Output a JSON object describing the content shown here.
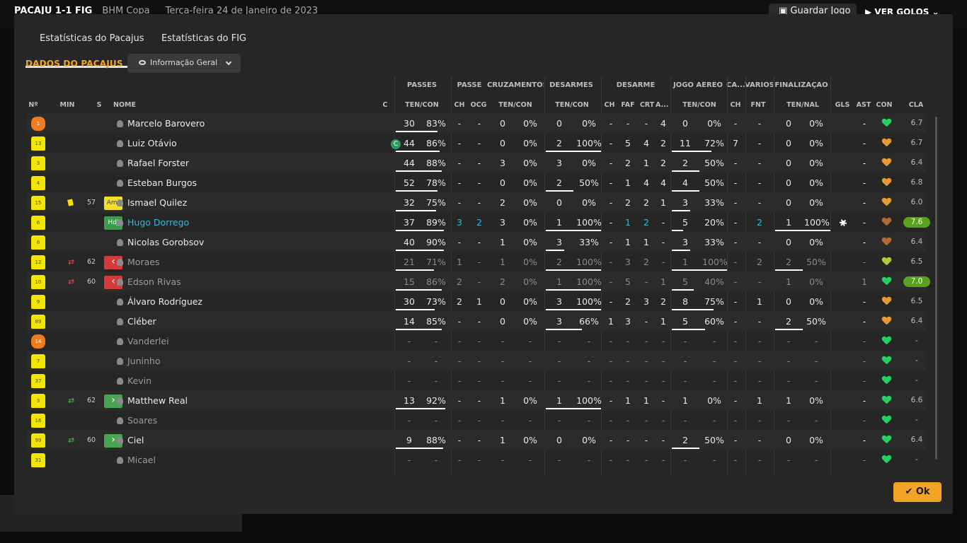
{
  "topbar": {
    "score": "PACAJU 1-1 FIG",
    "competition": "BHM Copa",
    "date": "Terça-feira 24 de Janeiro de 2023",
    "save_label": "Guardar Jogo",
    "goals_label": "VER GOLOS"
  },
  "modal": {
    "tabs": [
      "Estatísticas do Pacajus",
      "Estatísticas do FIG"
    ],
    "section_title": "DADOS DO PACAJUS",
    "view_dropdown": "Informação Geral",
    "ok_label": "Ok",
    "groups": [
      "PASSES",
      "PASSE",
      "CRUZAMENTOS",
      "DESARMES",
      "DESARME",
      "JOGO AÉREO",
      "CA...",
      "VÁRIOS",
      "FINALIZAÇÃO"
    ],
    "columns": [
      "Nº",
      "MIN",
      "S",
      "NOME",
      "C",
      "TEN/CON",
      "CH",
      "OCG",
      "TEN/CON",
      "TEN/CON",
      "CH",
      "FAF",
      "CRT",
      "A...",
      "TEN/CON",
      "CH",
      "FNT",
      "TEN/NAL",
      "GLS",
      "AST",
      "CON",
      "CLA"
    ]
  },
  "players": [
    {
      "num": "1",
      "gk": true,
      "min": "",
      "swap": "",
      "badge": "",
      "name": "Marcelo Barovero",
      "captain": false,
      "style": "",
      "p": [
        "30",
        "83%"
      ],
      "ps": [
        "-",
        "-"
      ],
      "cr": [
        "0",
        "0%"
      ],
      "de": [
        "0",
        "0%"
      ],
      "d2": [
        "-",
        "-",
        "-",
        "4"
      ],
      "ae": [
        "0",
        "0%"
      ],
      "ca": "-",
      "va": "-",
      "fi": [
        "0",
        "0%"
      ],
      "gls": "",
      "ast": "-",
      "con": "g",
      "cla": "6.7",
      "good": false,
      "bars": [
        0.78,
        0,
        0.0,
        0.0,
        0,
        0,
        0
      ]
    },
    {
      "num": "13",
      "gk": false,
      "min": "",
      "swap": "",
      "badge": "",
      "name": "Luiz Otávio",
      "captain": true,
      "style": "",
      "p": [
        "44",
        "86%"
      ],
      "ps": [
        "-",
        "-"
      ],
      "cr": [
        "0",
        "0%"
      ],
      "de": [
        "2",
        "100%"
      ],
      "d2": [
        "-",
        "5",
        "4",
        "2"
      ],
      "ae": [
        "11",
        "72%"
      ],
      "ca": "7",
      "va": "-",
      "fi": [
        "0",
        "0%"
      ],
      "gls": "",
      "ast": "-",
      "con": "o",
      "cla": "6.7",
      "good": false,
      "bars": [
        0.82,
        0,
        0,
        1,
        0.72,
        0
      ]
    },
    {
      "num": "3",
      "gk": false,
      "min": "",
      "swap": "",
      "badge": "",
      "name": "Rafael Forster",
      "captain": false,
      "style": "",
      "p": [
        "44",
        "88%"
      ],
      "ps": [
        "-",
        "-"
      ],
      "cr": [
        "3",
        "0%"
      ],
      "de": [
        "3",
        "0%"
      ],
      "d2": [
        "-",
        "2",
        "1",
        "2"
      ],
      "ae": [
        "2",
        "50%"
      ],
      "ca": "-",
      "va": "-",
      "fi": [
        "0",
        "0%"
      ],
      "gls": "",
      "ast": "-",
      "con": "o",
      "cla": "6.4",
      "good": false,
      "bars": [
        0.85,
        0,
        0,
        0,
        0.5,
        0
      ]
    },
    {
      "num": "4",
      "gk": false,
      "min": "",
      "swap": "",
      "badge": "",
      "name": "Esteban Burgos",
      "captain": false,
      "style": "",
      "p": [
        "52",
        "78%"
      ],
      "ps": [
        "-",
        "-"
      ],
      "cr": [
        "0",
        "0%"
      ],
      "de": [
        "2",
        "50%"
      ],
      "d2": [
        "-",
        "1",
        "4",
        "4"
      ],
      "ae": [
        "4",
        "50%"
      ],
      "ca": "-",
      "va": "-",
      "fi": [
        "0",
        "0%"
      ],
      "gls": "",
      "ast": "-",
      "con": "o",
      "cla": "6.8",
      "good": false,
      "bars": [
        0.78,
        0,
        0,
        0.5,
        0.5,
        0
      ]
    },
    {
      "num": "15",
      "gk": false,
      "min": "57",
      "swap": "y",
      "badge": "Amr",
      "name": "Ismael Quilez",
      "captain": false,
      "style": "",
      "p": [
        "32",
        "75%"
      ],
      "ps": [
        "-",
        "-"
      ],
      "cr": [
        "2",
        "0%"
      ],
      "de": [
        "0",
        "0%"
      ],
      "d2": [
        "-",
        "2",
        "2",
        "1"
      ],
      "ae": [
        "3",
        "33%"
      ],
      "ca": "-",
      "va": "-",
      "fi": [
        "0",
        "0%"
      ],
      "gls": "",
      "ast": "-",
      "con": "o",
      "cla": "6.0",
      "good": false,
      "bars": [
        0.75,
        0,
        0,
        0,
        0.33,
        0
      ]
    },
    {
      "num": "6",
      "gk": false,
      "min": "",
      "swap": "",
      "badge": "HdJ",
      "name": "Hugo Dorrego",
      "captain": false,
      "style": "hl",
      "p": [
        "37",
        "89%"
      ],
      "ps": [
        "3",
        "2"
      ],
      "cr": [
        "3",
        "0%"
      ],
      "de": [
        "1",
        "100%"
      ],
      "d2": [
        "-",
        "1",
        "2",
        "-"
      ],
      "ae": [
        "5",
        "20%"
      ],
      "ca": "-",
      "va": "2",
      "fi": [
        "1",
        "100%"
      ],
      "gls": "ball",
      "ast": "-",
      "con": "b",
      "cla": "7.6",
      "good": true,
      "bars": [
        0.89,
        0,
        0,
        1,
        0.2,
        1
      ]
    },
    {
      "num": "8",
      "gk": false,
      "min": "",
      "swap": "",
      "badge": "",
      "name": "Nicolas Gorobsov",
      "captain": false,
      "style": "",
      "p": [
        "40",
        "90%"
      ],
      "ps": [
        "-",
        "-"
      ],
      "cr": [
        "1",
        "0%"
      ],
      "de": [
        "3",
        "33%"
      ],
      "d2": [
        "-",
        "1",
        "1",
        "-"
      ],
      "ae": [
        "3",
        "33%"
      ],
      "ca": "-",
      "va": "-",
      "fi": [
        "0",
        "0%"
      ],
      "gls": "",
      "ast": "-",
      "con": "b",
      "cla": "6.4",
      "good": false,
      "bars": [
        0.9,
        0,
        0,
        0.33,
        0.33,
        0
      ]
    },
    {
      "num": "12",
      "gk": false,
      "min": "62",
      "swap": "out",
      "badge": "out",
      "name": "Moraes",
      "captain": false,
      "style": "dim",
      "p": [
        "21",
        "71%"
      ],
      "ps": [
        "1",
        "-"
      ],
      "cr": [
        "1",
        "0%"
      ],
      "de": [
        "2",
        "100%"
      ],
      "d2": [
        "-",
        "3",
        "2",
        "-"
      ],
      "ae": [
        "1",
        "100%"
      ],
      "ca": "-",
      "va": "2",
      "fi": [
        "2",
        "50%"
      ],
      "gls": "",
      "ast": "-",
      "con": "y",
      "cla": "6.5",
      "good": false,
      "bars": [
        0.71,
        0,
        0,
        1,
        1,
        0.5
      ]
    },
    {
      "num": "10",
      "gk": false,
      "min": "60",
      "swap": "out",
      "badge": "out",
      "name": "Edson Rivas",
      "captain": false,
      "style": "dim",
      "p": [
        "15",
        "86%"
      ],
      "ps": [
        "2",
        "-"
      ],
      "cr": [
        "2",
        "0%"
      ],
      "de": [
        "1",
        "100%"
      ],
      "d2": [
        "-",
        "5",
        "-",
        "1"
      ],
      "ae": [
        "5",
        "40%"
      ],
      "ca": "-",
      "va": "-",
      "fi": [
        "1",
        "0%"
      ],
      "gls": "",
      "ast": "1",
      "con": "g",
      "cla": "7.0",
      "good": true,
      "bars": [
        0.86,
        0,
        0,
        1,
        0.4,
        0
      ]
    },
    {
      "num": "9",
      "gk": false,
      "min": "",
      "swap": "",
      "badge": "",
      "name": "Álvaro Rodríguez",
      "captain": false,
      "style": "",
      "p": [
        "30",
        "73%"
      ],
      "ps": [
        "2",
        "1"
      ],
      "cr": [
        "0",
        "0%"
      ],
      "de": [
        "3",
        "100%"
      ],
      "d2": [
        "-",
        "2",
        "3",
        "2"
      ],
      "ae": [
        "8",
        "75%"
      ],
      "ca": "-",
      "va": "1",
      "fi": [
        "0",
        "0%"
      ],
      "gls": "",
      "ast": "-",
      "con": "o",
      "cla": "6.5",
      "good": false,
      "bars": [
        0.73,
        0,
        0,
        1,
        0.75,
        0
      ]
    },
    {
      "num": "89",
      "gk": false,
      "min": "",
      "swap": "",
      "badge": "",
      "name": "Cléber",
      "captain": false,
      "style": "",
      "p": [
        "14",
        "85%"
      ],
      "ps": [
        "-",
        "-"
      ],
      "cr": [
        "0",
        "0%"
      ],
      "de": [
        "3",
        "66%"
      ],
      "d2": [
        "1",
        "3",
        "-",
        "1"
      ],
      "ae": [
        "5",
        "60%"
      ],
      "ca": "-",
      "va": "-",
      "fi": [
        "2",
        "50%"
      ],
      "gls": "",
      "ast": "-",
      "con": "o",
      "cla": "6.4",
      "good": false,
      "bars": [
        0.85,
        0,
        0,
        0.66,
        0.6,
        0.5
      ]
    },
    {
      "num": "14",
      "gk": true,
      "min": "",
      "swap": "",
      "badge": "",
      "name": "Vanderlei",
      "captain": false,
      "style": "dim",
      "p": [
        "-",
        "-"
      ],
      "ps": [
        "-",
        "-"
      ],
      "cr": [
        "-",
        "-"
      ],
      "de": [
        "-",
        "-"
      ],
      "d2": [
        "-",
        "-",
        "-",
        "-"
      ],
      "ae": [
        "-",
        "-"
      ],
      "ca": "-",
      "va": "-",
      "fi": [
        "-",
        "-"
      ],
      "gls": "",
      "ast": "-",
      "con": "g",
      "cla": "-",
      "good": false,
      "bars": [
        0,
        0,
        0,
        0,
        0,
        0
      ]
    },
    {
      "num": "7",
      "gk": false,
      "min": "",
      "swap": "",
      "badge": "",
      "name": "Juninho",
      "captain": false,
      "style": "dim",
      "p": [
        "-",
        "-"
      ],
      "ps": [
        "-",
        "-"
      ],
      "cr": [
        "-",
        "-"
      ],
      "de": [
        "-",
        "-"
      ],
      "d2": [
        "-",
        "-",
        "-",
        "-"
      ],
      "ae": [
        "-",
        "-"
      ],
      "ca": "-",
      "va": "-",
      "fi": [
        "-",
        "-"
      ],
      "gls": "",
      "ast": "-",
      "con": "g",
      "cla": "-",
      "good": false,
      "bars": [
        0,
        0,
        0,
        0,
        0,
        0
      ]
    },
    {
      "num": "37",
      "gk": false,
      "min": "",
      "swap": "",
      "badge": "",
      "name": "Kevin",
      "captain": false,
      "style": "dim",
      "p": [
        "-",
        "-"
      ],
      "ps": [
        "-",
        "-"
      ],
      "cr": [
        "-",
        "-"
      ],
      "de": [
        "-",
        "-"
      ],
      "d2": [
        "-",
        "-",
        "-",
        "-"
      ],
      "ae": [
        "-",
        "-"
      ],
      "ca": "-",
      "va": "-",
      "fi": [
        "-",
        "-"
      ],
      "gls": "",
      "ast": "-",
      "con": "g",
      "cla": "-",
      "good": false,
      "bars": [
        0,
        0,
        0,
        0,
        0,
        0
      ]
    },
    {
      "num": "3",
      "gk": false,
      "min": "62",
      "swap": "in",
      "badge": "in",
      "name": "Matthew Real",
      "captain": false,
      "style": "",
      "p": [
        "13",
        "92%"
      ],
      "ps": [
        "-",
        "-"
      ],
      "cr": [
        "1",
        "0%"
      ],
      "de": [
        "1",
        "100%"
      ],
      "d2": [
        "-",
        "1",
        "1",
        "-"
      ],
      "ae": [
        "1",
        "0%"
      ],
      "ca": "-",
      "va": "1",
      "fi": [
        "1",
        "0%"
      ],
      "gls": "",
      "ast": "-",
      "con": "g",
      "cla": "6.6",
      "good": false,
      "bars": [
        0.92,
        0,
        0,
        1,
        0,
        0
      ]
    },
    {
      "num": "16",
      "gk": false,
      "min": "",
      "swap": "",
      "badge": "",
      "name": "Soares",
      "captain": false,
      "style": "dim",
      "p": [
        "-",
        "-"
      ],
      "ps": [
        "-",
        "-"
      ],
      "cr": [
        "-",
        "-"
      ],
      "de": [
        "-",
        "-"
      ],
      "d2": [
        "-",
        "-",
        "-",
        "-"
      ],
      "ae": [
        "-",
        "-"
      ],
      "ca": "-",
      "va": "-",
      "fi": [
        "-",
        "-"
      ],
      "gls": "",
      "ast": "-",
      "con": "g",
      "cla": "-",
      "good": false,
      "bars": [
        0,
        0,
        0,
        0,
        0,
        0
      ]
    },
    {
      "num": "99",
      "gk": false,
      "min": "60",
      "swap": "in",
      "badge": "in",
      "name": "Ciel",
      "captain": false,
      "style": "",
      "p": [
        "9",
        "88%"
      ],
      "ps": [
        "-",
        "-"
      ],
      "cr": [
        "1",
        "0%"
      ],
      "de": [
        "0",
        "0%"
      ],
      "d2": [
        "-",
        "-",
        "-",
        "-"
      ],
      "ae": [
        "2",
        "50%"
      ],
      "ca": "-",
      "va": "-",
      "fi": [
        "0",
        "0%"
      ],
      "gls": "",
      "ast": "-",
      "con": "g",
      "cla": "6.4",
      "good": false,
      "bars": [
        0.88,
        0,
        0,
        0,
        0.5,
        0
      ]
    },
    {
      "num": "31",
      "gk": false,
      "min": "",
      "swap": "",
      "badge": "",
      "name": "Micael",
      "captain": false,
      "style": "dim",
      "p": [
        "-",
        "-"
      ],
      "ps": [
        "-",
        "-"
      ],
      "cr": [
        "-",
        "-"
      ],
      "de": [
        "-",
        "-"
      ],
      "d2": [
        "-",
        "-",
        "-",
        "-"
      ],
      "ae": [
        "-",
        "-"
      ],
      "ca": "-",
      "va": "-",
      "fi": [
        "-",
        "-"
      ],
      "gls": "",
      "ast": "-",
      "con": "g",
      "cla": "-",
      "good": false,
      "bars": [
        0,
        0,
        0,
        0,
        0,
        0
      ]
    }
  ]
}
